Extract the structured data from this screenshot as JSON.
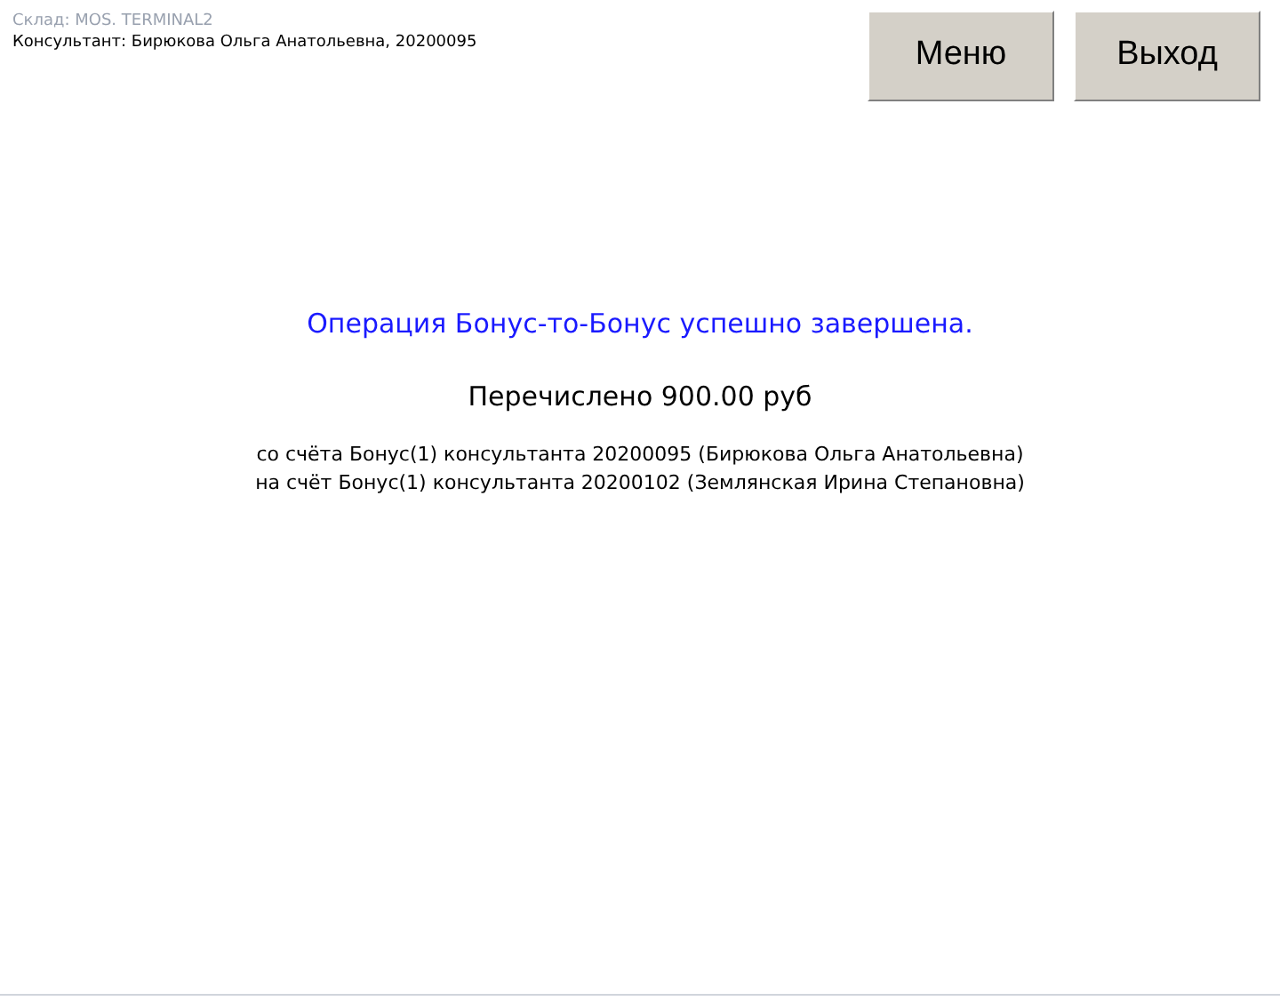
{
  "header": {
    "warehouse": "Склад: MOS. TERMINAL2",
    "consultant": "Консультант: Бирюкова Ольга Анатольевна, 20200095"
  },
  "buttons": [
    {
      "label": "Меню"
    },
    {
      "label": "Выход"
    }
  ],
  "message": {
    "title": "Операция Бонус-то-Бонус успешно завершена.",
    "amount": "Перечислено 900.00 руб",
    "details": [
      "со счёта Бонус(1) консультанта 20200095 (Бирюкова Ольга Анатольевна)",
      "на счёт Бонус(1) консультанта 20200102 (Землянская Ирина Степановна)"
    ]
  }
}
